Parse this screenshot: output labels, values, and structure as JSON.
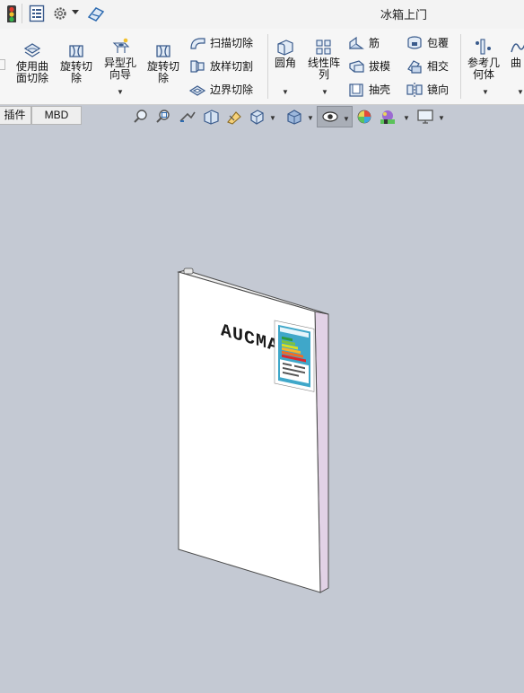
{
  "titlebar": {
    "document_title": "冰箱上门",
    "icons": [
      "traffic-light-icon",
      "properties-list-icon",
      "gear-icon",
      "dropdown-caret-icon",
      "pin-icon"
    ]
  },
  "ribbon": {
    "large_buttons": [
      {
        "name": "use-surface-cut",
        "label_line1": "使用曲",
        "label_line2": "面切除"
      },
      {
        "name": "revolve-cut-1",
        "label_line1": "旋转切",
        "label_line2": "除"
      },
      {
        "name": "hole-wizard",
        "label_line1": "异型孔",
        "label_line2": "向导"
      },
      {
        "name": "revolve-cut-2",
        "label_line1": "旋转切",
        "label_line2": "除"
      },
      {
        "name": "fillet",
        "label_line1": "圆角",
        "label_line2": ""
      },
      {
        "name": "linear-pattern",
        "label_line1": "线性阵",
        "label_line2": "列"
      },
      {
        "name": "reference-geometry",
        "label_line1": "参考几",
        "label_line2": "何体"
      },
      {
        "name": "curves",
        "label_line1": "曲",
        "label_line2": ""
      }
    ],
    "small_buttons": {
      "swept_cut": "扫描切除",
      "lofted_cut": "放样切割",
      "boundary_cut": "边界切除",
      "rib": "筋",
      "draft": "拔模",
      "shell": "抽壳",
      "wrap": "包覆",
      "intersect": "相交",
      "mirror": "镜向"
    }
  },
  "tabs": [
    {
      "label": "插件"
    },
    {
      "label": "MBD"
    }
  ],
  "view_toolbar": {
    "icons": [
      "zoom-to-fit-icon",
      "zoom-to-area-icon",
      "previous-view-icon",
      "section-view-icon",
      "dynamic-annotation-icon",
      "view-orientation-icon",
      "display-style-icon",
      "hide-show-items-icon",
      "edit-appearance-icon",
      "apply-scene-icon",
      "view-settings-icon"
    ]
  },
  "model": {
    "brand_text": "AUCMA",
    "energy_label": {
      "header": "中国能效标识",
      "bar_colors": [
        "#2e9b3c",
        "#7dc242",
        "#d9e021",
        "#f7b52b",
        "#f26c23",
        "#e0262b"
      ],
      "panel_color": "#3fa7c9"
    }
  },
  "colors": {
    "viewport_background": "#c4c9d3",
    "ribbon_background": "#f6f6f6",
    "door_face": "#ffffff",
    "door_edge": "#e2d2e6"
  }
}
